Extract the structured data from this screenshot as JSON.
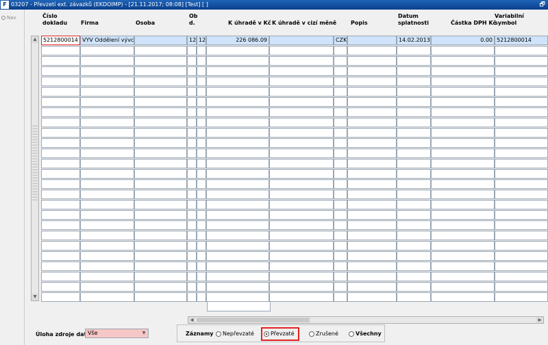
{
  "window": {
    "title": "03207 - Převzetí ext. závazků (EKDOIMP) - [21.11.2017; 08:08] [Test] [ ]",
    "app_icon": "F",
    "restore_icon": "restore-icon"
  },
  "sidebar": {
    "nav_label": "Nav"
  },
  "table": {
    "headers": {
      "doc": [
        "Číslo",
        "dokladu"
      ],
      "firma": "Firma",
      "osoba": "Osoba",
      "obd": [
        "Ob",
        "d."
      ],
      "k_uhrade_kc": "K úhradě v Kč",
      "k_uhrade_cm": "K úhradě v cizí měně",
      "popis": "Popis",
      "datum": [
        "Datum",
        "splatnosti"
      ],
      "dph": "Částka DPH Kč",
      "var": [
        "Variabilní",
        "symbol"
      ]
    },
    "rows": [
      {
        "doc": "5212800014",
        "firma": "VYV Oddělení vývc",
        "osoba": "",
        "o1": "12",
        "o2": "12",
        "k_uhrade_kc": "226 086.09",
        "k_uhrade_cm": "",
        "mena": "CZK",
        "popis": "",
        "datum": "14.02.2013",
        "dph": "0.00",
        "var": "5212800014"
      }
    ],
    "empty_rows": 25
  },
  "source": {
    "label": "Úloha zdroje dat",
    "value": "Vše"
  },
  "records": {
    "label": "Záznamy",
    "options": [
      {
        "label": "Nepřevzaté",
        "selected": false,
        "bold": false
      },
      {
        "label": "Převzaté",
        "selected": true,
        "bold": false
      },
      {
        "label": "Zrušené",
        "selected": false,
        "bold": false
      },
      {
        "label": "Všechny",
        "selected": false,
        "bold": true
      }
    ]
  }
}
